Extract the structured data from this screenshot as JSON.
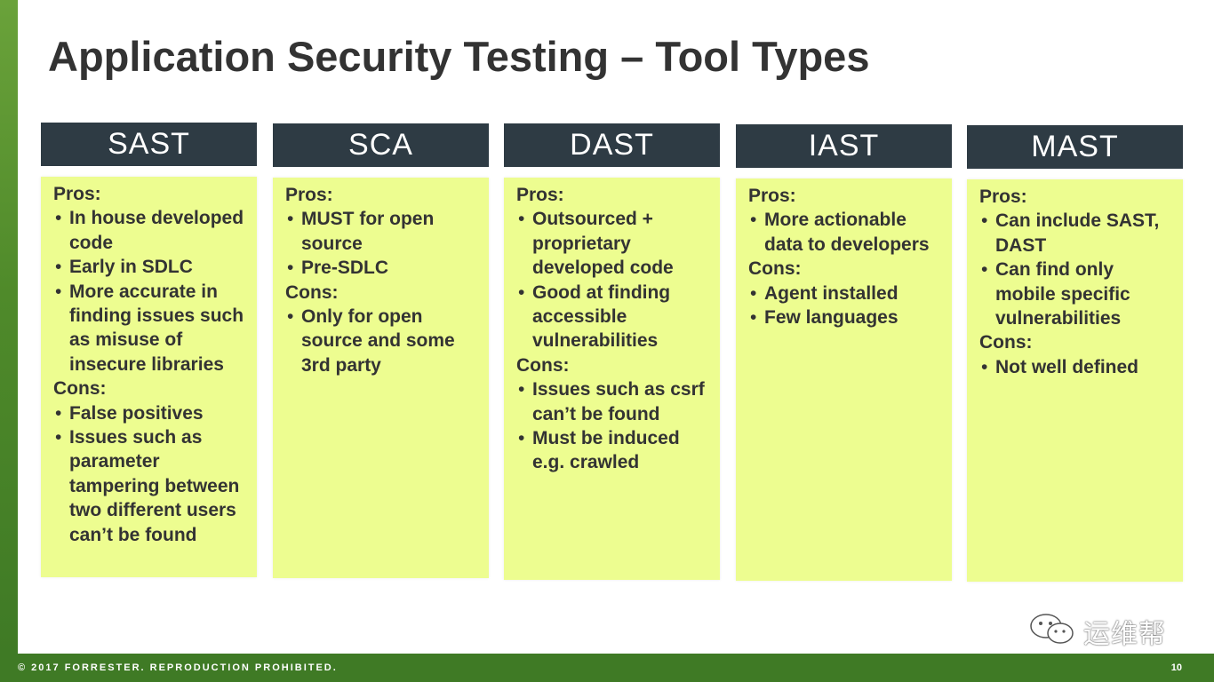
{
  "slide": {
    "title": "Application Security Testing – Tool Types",
    "footer_text": "© 2017 FORRESTER. REPRODUCTION PROHIBITED.",
    "page_number": "10",
    "watermark": "运维帮"
  },
  "columns": [
    {
      "header": "SAST",
      "pros_label": "Pros:",
      "pros": [
        "In house developed code",
        "Early in SDLC",
        "More accurate in finding issues such as misuse of insecure libraries"
      ],
      "cons_label": "Cons:",
      "cons": [
        "False positives",
        "Issues such as parameter tampering between two different users can’t be found"
      ]
    },
    {
      "header": "SCA",
      "pros_label": "Pros:",
      "pros": [
        "MUST for open source",
        "Pre-SDLC"
      ],
      "cons_label": "Cons:",
      "cons": [
        "Only for open source and some 3rd party"
      ]
    },
    {
      "header": "DAST",
      "pros_label": "Pros:",
      "pros": [
        "Outsourced + proprietary developed code",
        "Good at finding accessible vulnerabilities"
      ],
      "cons_label": "Cons:",
      "cons": [
        "Issues such as csrf can’t be found",
        "Must be induced e.g. crawled"
      ]
    },
    {
      "header": "IAST",
      "pros_label": "Pros:",
      "pros": [
        "More actionable data to developers"
      ],
      "cons_label": "Cons:",
      "cons": [
        "Agent installed",
        "Few languages"
      ]
    },
    {
      "header": "MAST",
      "pros_label": "Pros:",
      "pros": [
        "Can include SAST, DAST",
        "Can find only mobile specific vulnerabilities"
      ],
      "cons_label": "Cons:",
      "cons": [
        "Not well defined"
      ]
    }
  ],
  "colors": {
    "header_bg": "#2e3b44",
    "card_bg": "#edfd90",
    "accent_green": "#3f7a25",
    "text": "#333333"
  }
}
